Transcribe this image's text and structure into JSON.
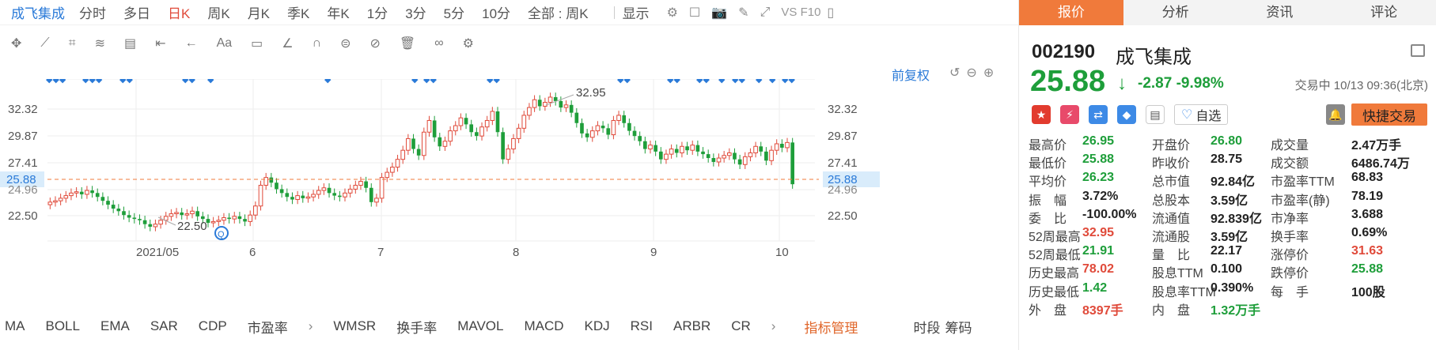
{
  "toolbar": {
    "symbol": "成飞集成",
    "periods": [
      "分时",
      "多日",
      "日K",
      "周K",
      "月K",
      "季K",
      "年K",
      "1分",
      "3分",
      "5分",
      "10分"
    ],
    "active_period": "日K",
    "range_label": "全部 : 周K",
    "display_label": "显示",
    "vs_label": "VS F10"
  },
  "chart": {
    "fuquan_label": "前复权",
    "price_axis": [
      "32.32",
      "29.87",
      "27.41",
      "25.88",
      "24.96",
      "22.50"
    ],
    "x_labels": [
      "2021/05",
      "6",
      "7",
      "8",
      "9",
      "10"
    ],
    "current_price_tag": "25.88",
    "high_annotation": "32.95",
    "low_annotation": "22.50"
  },
  "chart_data": {
    "type": "candlestick",
    "title": "",
    "ylim": [
      21.5,
      34.0
    ],
    "current_price": 25.88,
    "max_label": 32.95,
    "min_label": 22.5,
    "x_ticks": [
      "2021/05",
      "6",
      "7",
      "8",
      "9",
      "10"
    ],
    "y_ticks": [
      32.32,
      29.87,
      27.41,
      24.96,
      22.5
    ],
    "grid": true
  },
  "indicators": {
    "items": [
      "MA",
      "BOLL",
      "EMA",
      "SAR",
      "CDP",
      "市盈率"
    ],
    "items2": [
      "WMSR",
      "换手率",
      "MAVOL",
      "MACD",
      "KDJ",
      "RSI",
      "ARBR",
      "CR"
    ],
    "manage_label": "指标管理",
    "right_items": [
      "时段",
      "筹码"
    ]
  },
  "panel": {
    "tabs": [
      "报价",
      "分析",
      "资讯",
      "评论"
    ],
    "active_tab": "报价",
    "code": "002190",
    "name": "成飞集成",
    "price": "25.88",
    "change": "-2.87",
    "change_pct": "-9.98%",
    "status": "交易中 10/13 09:36(北京)",
    "zixuan_label": "自选",
    "fast_trade_label": "快捷交易",
    "stats": [
      [
        {
          "k": "最高价",
          "v": "26.95",
          "c": "down"
        },
        {
          "k": "开盘价",
          "v": "26.80",
          "c": "down"
        },
        {
          "k": "成交量",
          "v": "2.47万手",
          "c": "neu"
        }
      ],
      [
        {
          "k": "最低价",
          "v": "25.88",
          "c": "down"
        },
        {
          "k": "昨收价",
          "v": "28.75",
          "c": "neu"
        },
        {
          "k": "成交额",
          "v": "6486.74万",
          "c": "neu"
        }
      ],
      [
        {
          "k": "平均价",
          "v": "26.23",
          "c": "down"
        },
        {
          "k": "总市值",
          "v": "92.84亿",
          "c": "neu"
        },
        {
          "k": "市盈率TTM",
          "v": "68.83",
          "c": "neu"
        }
      ],
      [
        {
          "k": "振　幅",
          "v": "3.72%",
          "c": "neu"
        },
        {
          "k": "总股本",
          "v": "3.59亿",
          "c": "neu"
        },
        {
          "k": "市盈率(静)",
          "v": "78.19",
          "c": "neu"
        }
      ],
      [
        {
          "k": "委　比",
          "v": "-100.00%",
          "c": "neu"
        },
        {
          "k": "流通值",
          "v": "92.839亿",
          "c": "neu"
        },
        {
          "k": "市净率",
          "v": "3.688",
          "c": "neu"
        }
      ],
      [
        {
          "k": "52周最高",
          "v": "32.95",
          "c": "up"
        },
        {
          "k": "流通股",
          "v": "3.59亿",
          "c": "neu"
        },
        {
          "k": "换手率",
          "v": "0.69%",
          "c": "neu"
        }
      ],
      [
        {
          "k": "52周最低",
          "v": "21.91",
          "c": "down"
        },
        {
          "k": "量　比",
          "v": "22.17",
          "c": "neu"
        },
        {
          "k": "涨停价",
          "v": "31.63",
          "c": "up"
        }
      ],
      [
        {
          "k": "历史最高",
          "v": "78.02",
          "c": "up"
        },
        {
          "k": "股息TTM",
          "v": "0.100",
          "c": "neu"
        },
        {
          "k": "跌停价",
          "v": "25.88",
          "c": "down"
        }
      ],
      [
        {
          "k": "历史最低",
          "v": "1.42",
          "c": "down"
        },
        {
          "k": "股息率TTM",
          "v": "0.390%",
          "c": "neu"
        },
        {
          "k": "每　手",
          "v": "100股",
          "c": "neu"
        }
      ],
      [
        {
          "k": "外　盘",
          "v": "8397手",
          "c": "up"
        },
        {
          "k": "内　盘",
          "v": "1.32万手",
          "c": "down"
        },
        {
          "k": "",
          "v": "",
          "c": "neu"
        }
      ]
    ]
  },
  "colors": {
    "up": "#e04a3a",
    "down": "#1e9e3a",
    "accent": "#f07a3b",
    "link": "#2a7ad8"
  }
}
